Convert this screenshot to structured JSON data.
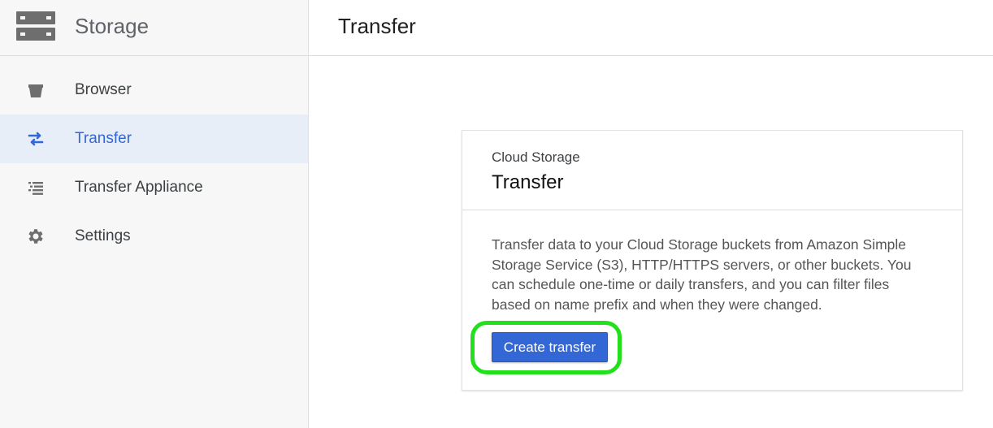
{
  "sidebar": {
    "product_title": "Storage",
    "product_icon": "storage-icon",
    "items": [
      {
        "label": "Browser",
        "icon": "bucket-icon",
        "active": false
      },
      {
        "label": "Transfer",
        "icon": "transfer-arrows-icon",
        "active": true
      },
      {
        "label": "Transfer Appliance",
        "icon": "list-icon",
        "active": false
      },
      {
        "label": "Settings",
        "icon": "gear-icon",
        "active": false
      }
    ]
  },
  "header": {
    "page_title": "Transfer"
  },
  "card": {
    "kicker": "Cloud Storage",
    "title": "Transfer",
    "description": "Transfer data to your Cloud Storage buckets from Amazon Simple Storage Service (S3), HTTP/HTTPS servers, or other buckets. You can schedule one-time or daily transfers, and you can filter files based on name prefix and when they were changed.",
    "primary_button": "Create transfer"
  },
  "colors": {
    "accent": "#3367d6",
    "active_nav_bg": "#e8eef8",
    "highlight": "#22e01b",
    "icon_gray": "#6e6e6e"
  }
}
